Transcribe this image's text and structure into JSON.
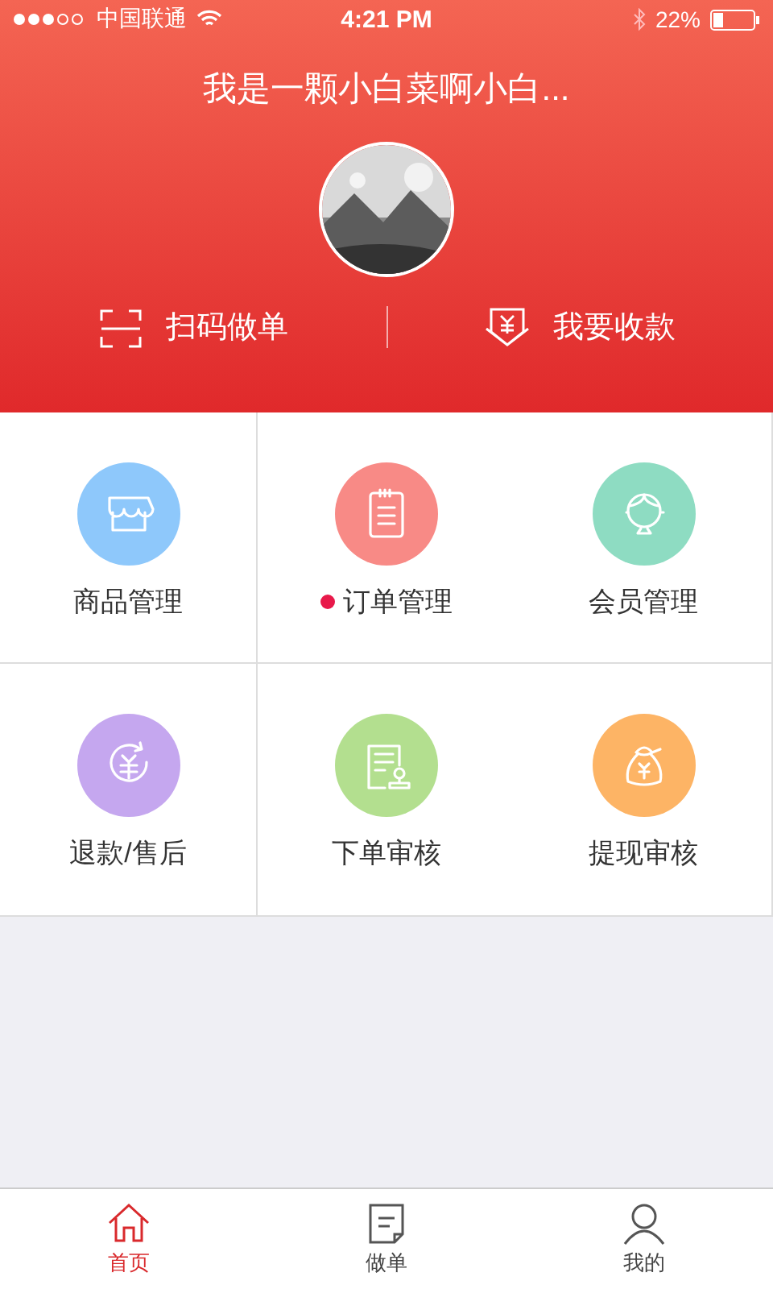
{
  "status_bar": {
    "carrier": "中国联通",
    "time": "4:21 PM",
    "battery": "22%"
  },
  "header": {
    "title": "我是一颗小白菜啊小白...",
    "actions": [
      {
        "kind": "scan",
        "label": "扫码做单"
      },
      {
        "kind": "receive",
        "label": "我要收款"
      }
    ]
  },
  "menu": [
    {
      "kind": "shop",
      "label": "商品管理",
      "color": "#8ec8fb",
      "dot": false
    },
    {
      "kind": "order",
      "label": "订单管理",
      "color": "#f88a86",
      "dot": true
    },
    {
      "kind": "member",
      "label": "会员管理",
      "color": "#8edcc2",
      "dot": false
    },
    {
      "kind": "refund",
      "label": "退款/售后",
      "color": "#c5a7ef",
      "dot": false
    },
    {
      "kind": "review",
      "label": "下单审核",
      "color": "#b3df8f",
      "dot": false
    },
    {
      "kind": "withdraw",
      "label": "提现审核",
      "color": "#fdb465",
      "dot": false
    }
  ],
  "tab_bar": [
    {
      "kind": "home",
      "label": "首页",
      "selected": true
    },
    {
      "kind": "doc",
      "label": "做单",
      "selected": false
    },
    {
      "kind": "person",
      "label": "我的",
      "selected": false
    }
  ]
}
